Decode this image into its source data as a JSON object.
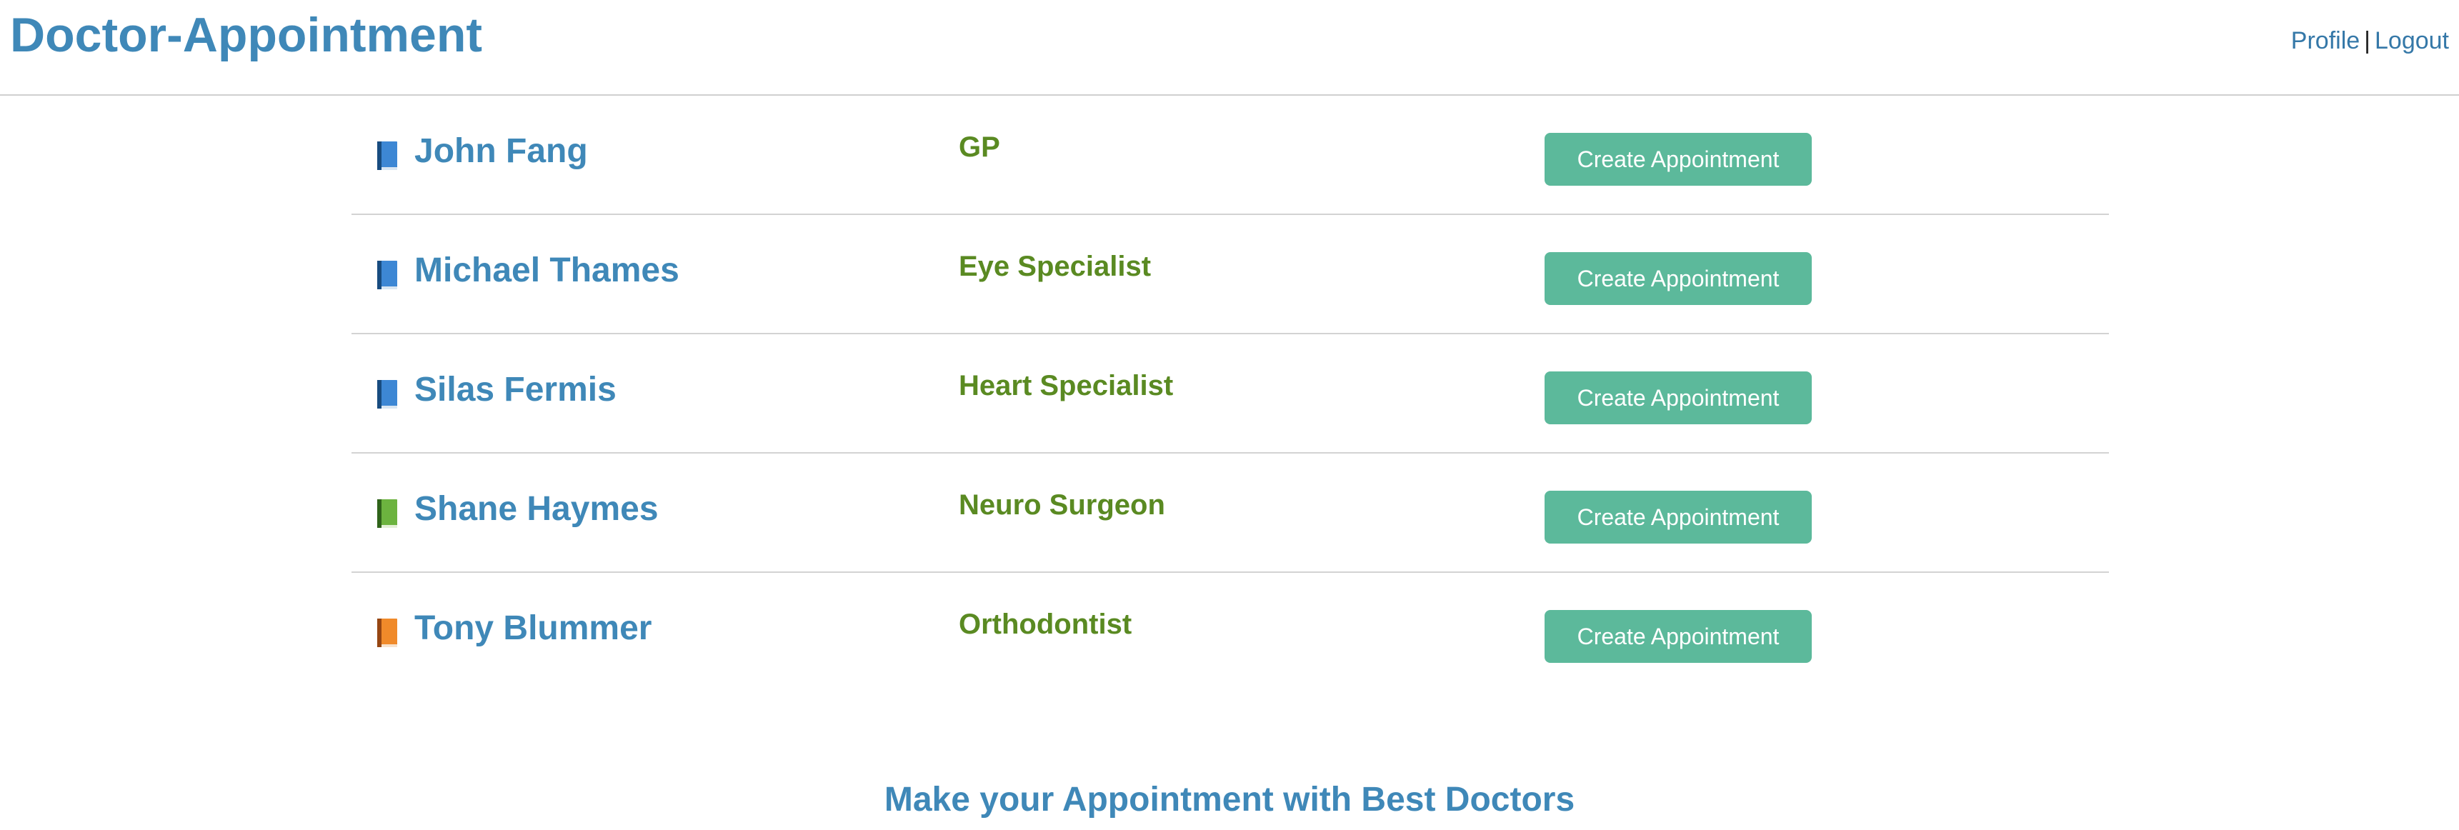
{
  "header": {
    "title": "Doctor-Appointment",
    "profile_link": "Profile",
    "separator": "|",
    "logout_link": "Logout"
  },
  "doctors": [
    {
      "name": "John Fang",
      "specialty": "GP",
      "button": "Create Appointment",
      "icon": "blue-book-icon",
      "icon_color": "#2f6fb3"
    },
    {
      "name": "Michael Thames",
      "specialty": "Eye Specialist",
      "button": "Create Appointment",
      "icon": "blue-book-icon",
      "icon_color": "#2f6fb3"
    },
    {
      "name": "Silas Fermis",
      "specialty": "Heart Specialist",
      "button": "Create Appointment",
      "icon": "blue-book-icon",
      "icon_color": "#2f6fb3"
    },
    {
      "name": "Shane Haymes",
      "specialty": "Neuro Surgeon",
      "button": "Create Appointment",
      "icon": "green-book-icon",
      "icon_color": "#4f9a2e"
    },
    {
      "name": "Tony Blummer",
      "specialty": "Orthodontist",
      "button": "Create Appointment",
      "icon": "orange-book-icon",
      "icon_color": "#e07a1f"
    }
  ],
  "footer": {
    "tagline": "Make your Appointment with Best Doctors"
  },
  "colors": {
    "title": "#3f88b8",
    "specialty": "#5a8a22",
    "button": "#5cb99b"
  }
}
